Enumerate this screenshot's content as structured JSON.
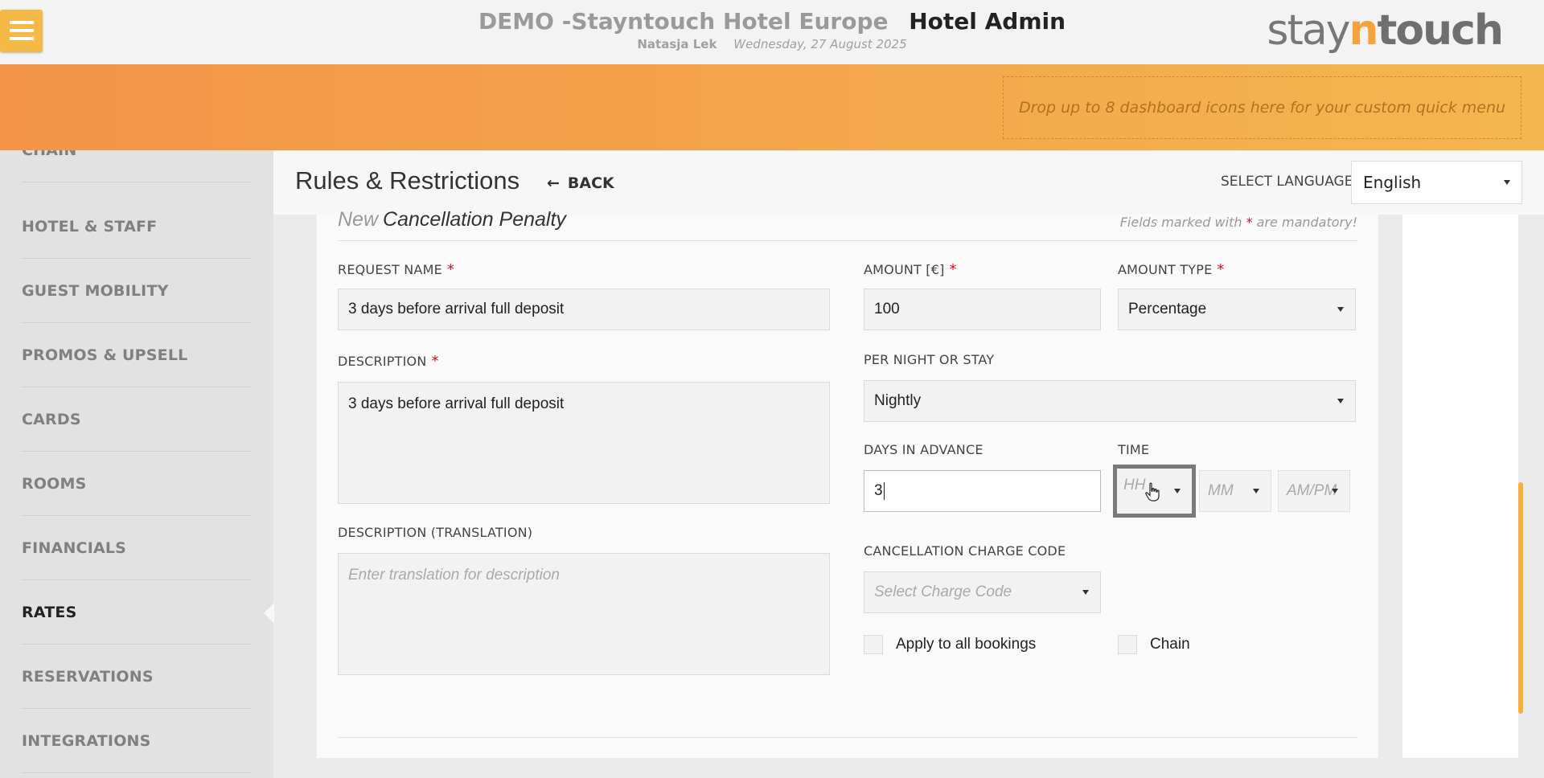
{
  "header": {
    "hotel_name": "DEMO -Stayntouch Hotel Europe",
    "app_title": "Hotel Admin",
    "user_name": "Natasja Lek",
    "date": "Wednesday, 27 August 2025",
    "brand_pre": "stay",
    "brand_n": "n",
    "brand_post": "touch",
    "menu_icon": "hamburger-icon"
  },
  "quick_menu": {
    "placeholder": "Drop up to 8 dashboard icons here for your custom quick menu"
  },
  "sidebar": {
    "items": [
      {
        "label": "CHAIN",
        "active": false
      },
      {
        "label": "HOTEL & STAFF",
        "active": false
      },
      {
        "label": "GUEST MOBILITY",
        "active": false
      },
      {
        "label": "PROMOS & UPSELL",
        "active": false
      },
      {
        "label": "CARDS",
        "active": false
      },
      {
        "label": "ROOMS",
        "active": false
      },
      {
        "label": "FINANCIALS",
        "active": false
      },
      {
        "label": "RATES",
        "active": true
      },
      {
        "label": "RESERVATIONS",
        "active": false
      },
      {
        "label": "INTEGRATIONS",
        "active": false
      }
    ]
  },
  "page": {
    "title": "Rules & Restrictions",
    "back_label": "BACK",
    "select_language_label": "SELECT LANGUAGE",
    "language": "English"
  },
  "form": {
    "title_prefix": "New",
    "title": "Cancellation Penalty",
    "mandatory_pre": "Fields marked with",
    "mandatory_star": "*",
    "mandatory_post": "are mandatory!",
    "request_name_label": "REQUEST NAME",
    "request_name_value": "3 days before arrival full deposit",
    "description_label": "DESCRIPTION",
    "description_value": "3 days before arrival full deposit",
    "description_translation_label": "DESCRIPTION (TRANSLATION)",
    "description_translation_placeholder": "Enter translation for description",
    "amount_label": "AMOUNT [€]",
    "amount_value": "100",
    "amount_type_label": "AMOUNT TYPE",
    "amount_type_value": "Percentage",
    "per_night_label": "PER NIGHT OR STAY",
    "per_night_value": "Nightly",
    "days_in_advance_label": "DAYS IN ADVANCE",
    "days_in_advance_value": "3",
    "time_label": "TIME",
    "time_hh": "HH",
    "time_mm": "MM",
    "time_ampm": "AM/PM",
    "charge_code_label": "CANCELLATION CHARGE CODE",
    "charge_code_placeholder": "Select Charge Code",
    "apply_all_label": "Apply to all bookings",
    "chain_label": "Chain",
    "required_star": "*"
  }
}
